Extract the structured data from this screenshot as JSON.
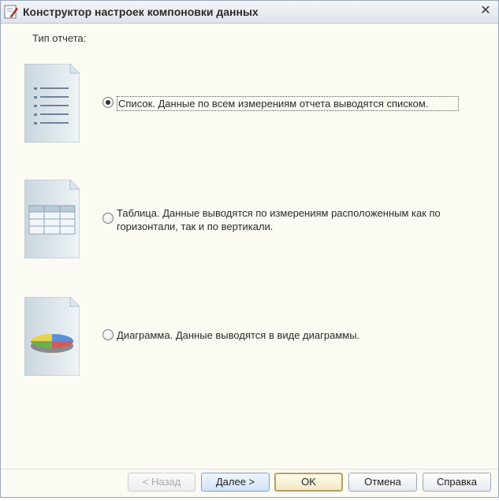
{
  "window": {
    "title": "Конструктор настроек компоновки данных",
    "icon": "wizard-pencil-icon",
    "close_label": "✕"
  },
  "report_type": {
    "group_label": "Тип отчета:",
    "options": [
      {
        "label": "Список. Данные по всем измерениям отчета выводятся списком.",
        "checked": true,
        "icon": "list-document-icon"
      },
      {
        "label": "Таблица. Данные выводятся по измерениям расположенным как по горизонтали, так и по вертикали.",
        "checked": false,
        "icon": "table-document-icon"
      },
      {
        "label": "Диаграмма. Данные выводятся в виде диаграммы.",
        "checked": false,
        "icon": "chart-document-icon"
      }
    ]
  },
  "buttons": {
    "back": "< Назад",
    "next": "Далее >",
    "ok": "OK",
    "cancel": "Отмена",
    "help": "Справка"
  },
  "colors": {
    "accent": "#7f9ec4",
    "window_bg": "#fbfbf4"
  }
}
